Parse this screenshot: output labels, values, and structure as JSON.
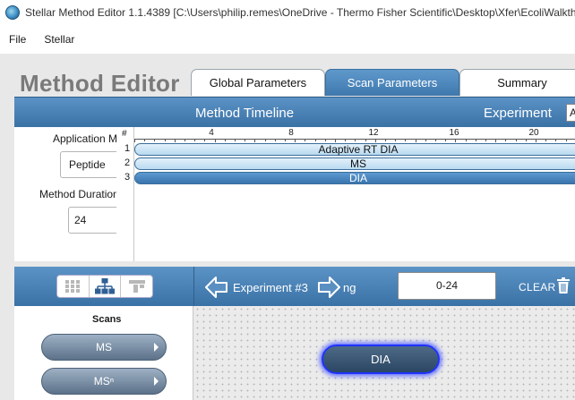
{
  "window": {
    "title": "Stellar Method Editor 1.1.4389  [C:\\Users\\philip.remes\\OneDrive - Thermo Fisher Scientific\\Desktop\\Xfer\\EcoliWalkth"
  },
  "menu": {
    "items": [
      "File",
      "Stellar"
    ]
  },
  "header": {
    "title": "Method Editor"
  },
  "tabs": [
    {
      "label": "Global Parameters",
      "active": false
    },
    {
      "label": "Scan Parameters",
      "active": true
    },
    {
      "label": "Summary",
      "active": false
    }
  ],
  "timeline": {
    "title": "Method Timeline",
    "experiment_label": "Experiment",
    "experiment_value": "A",
    "application_label": "Application M",
    "application_value": "Peptide",
    "duration_label": "Method Duration",
    "duration_value": "24",
    "ruler_header": "#",
    "ticks": [
      "4",
      "8",
      "12",
      "16",
      "20"
    ],
    "rows": [
      {
        "num": "1",
        "label": "Adaptive RT DIA"
      },
      {
        "num": "2",
        "label": "MS"
      },
      {
        "num": "3",
        "label": "DIA"
      }
    ]
  },
  "editor": {
    "experiment_label": "Experiment #3",
    "experiment_trunc": "ng",
    "range_value": "0-24",
    "clear_label": "CLEAR",
    "scans_title": "Scans",
    "scans": [
      "MS",
      "MSⁿ"
    ],
    "node_label": "DIA"
  },
  "colors": {
    "panel_blue": "#3b72a6",
    "tab_active": "#4f89bd",
    "node_glow": "#1f33ff"
  }
}
